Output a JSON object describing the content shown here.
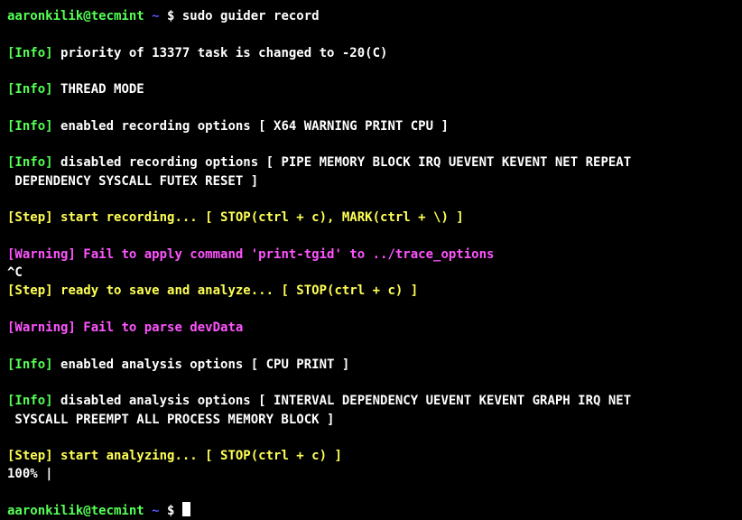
{
  "prompt": {
    "user_host": "aaronkilik@tecmint",
    "tilde": " ~ ",
    "dollar": "$ ",
    "command": "sudo guider record"
  },
  "lines": {
    "l1a": "[Info] ",
    "l1b": "priority of 13377 task is changed to -20(C)",
    "l2a": "[Info] ",
    "l2b": "THREAD MODE",
    "l3a": "[Info] ",
    "l3b": "enabled recording options [ X64 WARNING PRINT CPU ]",
    "l4a": "[Info] ",
    "l4b": "disabled recording options [ PIPE MEMORY BLOCK IRQ UEVENT KEVENT NET REPEAT",
    "l4c": " DEPENDENCY SYSCALL FUTEX RESET ]",
    "l5a": "[Step] ",
    "l5b": "start recording... [ STOP(ctrl + c), MARK(ctrl + \\) ]",
    "l6a": "[Warning] ",
    "l6b": "Fail to apply command 'print-tgid' to ../trace_options",
    "l7": "^C",
    "l8a": "[Step] ",
    "l8b": "ready to save and analyze... [ STOP(ctrl + c) ]",
    "l9a": "[Warning] ",
    "l9b": "Fail to parse devData",
    "l10a": "[Info] ",
    "l10b": "enabled analysis options [ CPU PRINT ]",
    "l11a": "[Info] ",
    "l11b": "disabled analysis options [ INTERVAL DEPENDENCY UEVENT KEVENT GRAPH IRQ NET",
    "l11c": " SYSCALL PREEMPT ALL PROCESS MEMORY BLOCK ]",
    "l12a": "[Step] ",
    "l12b": "start analyzing... [ STOP(ctrl + c) ]",
    "l13": "100% |"
  }
}
